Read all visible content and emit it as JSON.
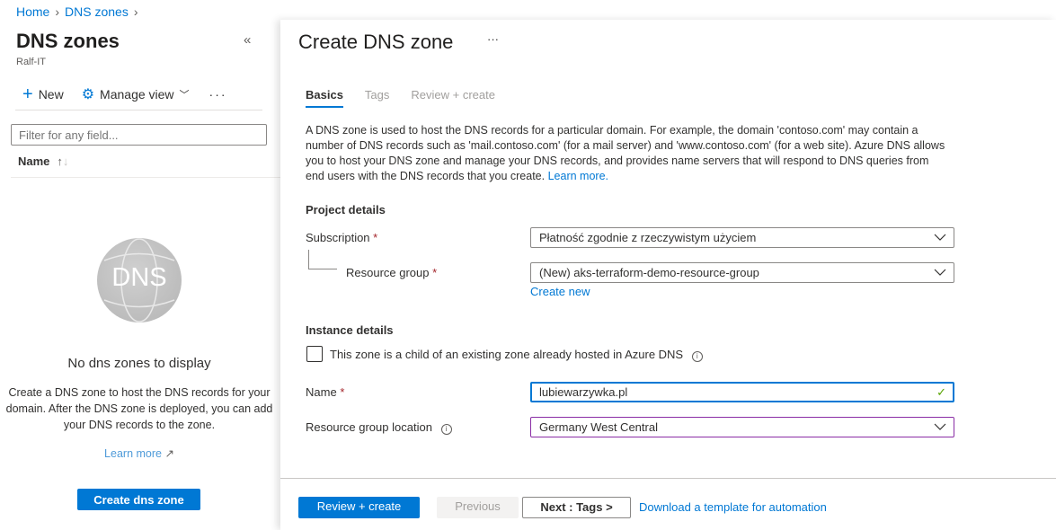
{
  "breadcrumb": {
    "home": "Home",
    "dns_zones": "DNS zones"
  },
  "left": {
    "title": "DNS zones",
    "subtitle": "Ralf-IT",
    "toolbar": {
      "new": "New",
      "manage_view": "Manage view"
    },
    "filter_placeholder": "Filter for any field...",
    "column_name": "Name",
    "empty": {
      "logo_text": "DNS",
      "title": "No dns zones to display",
      "description": "Create a DNS zone to host the DNS records for your domain. After the DNS zone is deployed, you can add your DNS records to the zone.",
      "learn_more": "Learn more",
      "create_button": "Create dns zone"
    }
  },
  "right": {
    "title": "Create DNS zone",
    "tabs": [
      {
        "label": "Basics",
        "active": true
      },
      {
        "label": "Tags"
      },
      {
        "label": "Review + create"
      }
    ],
    "description": "A DNS zone is used to host the DNS records for a particular domain. For example, the domain 'contoso.com' may contain a number of DNS records such as 'mail.contoso.com' (for a mail server) and 'www.contoso.com' (for a web site). Azure DNS allows you to host your DNS zone and manage your DNS records, and provides name servers that will respond to DNS queries from end users with the DNS records that you create.",
    "learn_more": "Learn more.",
    "project_details": "Project details",
    "subscription_label": "Subscription",
    "subscription_value": "Płatność zgodnie z rzeczywistym użyciem",
    "resource_group_label": "Resource group",
    "resource_group_value": "(New) aks-terraform-demo-resource-group",
    "create_new": "Create new",
    "instance_details": "Instance details",
    "child_zone_label": "This zone is a child of an existing zone already hosted in Azure DNS",
    "child_zone_checked": false,
    "name_label": "Name",
    "name_value": "lubiewarzywka.pl",
    "location_label": "Resource group location",
    "location_value": "Germany West Central",
    "required_mark": "*"
  },
  "footer": {
    "review_create": "Review + create",
    "previous": "Previous",
    "next": "Next : Tags >",
    "download": "Download a template for automation"
  },
  "colors": {
    "accent": "#0078d4",
    "valid": "#57a300",
    "location_border": "#8a2da5"
  }
}
